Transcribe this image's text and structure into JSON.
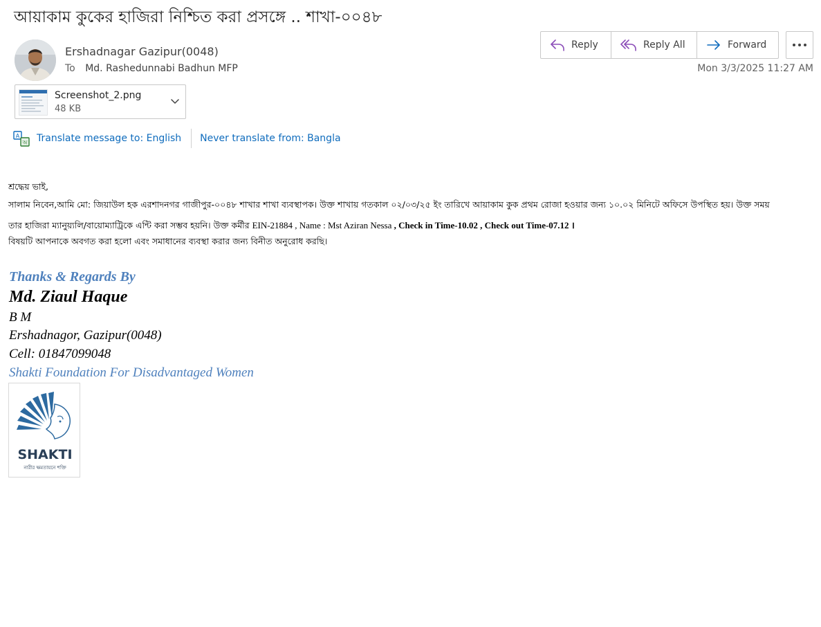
{
  "email": {
    "subject": "আয়াকাম কুকের হাজিরা নিশ্চিত করা প্রসঙ্গে .. শাখা-০০৪৮",
    "sender": "Ershadnagar Gazipur(0048)",
    "to_label": "To",
    "recipient": "Md. Rashedunnabi Badhun MFP",
    "date": "Mon 3/3/2025 11:27 AM"
  },
  "actions": {
    "reply": "Reply",
    "reply_all": "Reply All",
    "forward": "Forward",
    "more_icon": "more-horizontal-icon"
  },
  "attachment": {
    "name": "Screenshot_2.png",
    "size": "48 KB"
  },
  "translate": {
    "to_english": "Translate message to: English",
    "never_translate": "Never translate from: Bangla"
  },
  "body": {
    "greeting": "শ্রদ্ধেয় ভাই,",
    "line1": "সালাম নিবেন,আমি মো: জিয়াউল হক এরশাদনগর গাজীপুর-০০৪৮ শাখার শাখা ব্যবস্থাপক। উক্ত শাখায় গতকাল ০২/০৩/২৫ ইং তারিখে আয়াকাম কুক প্রথম রোজা হওয়ার জন্য ১০.০২ মিনিটে অফিসে উপস্থিত হয়। উক্ত সময়",
    "line2_a": "তার হাজিরা ম্যানুয়্যলি/বায়োম্যাট্রিকে এন্টি করা সম্ভব হয়নি। উক্ত কর্মীর ",
    "line2_b": "EIN-21884 ,  Name : Mst Aziran Nessa   ",
    "line2_c": ", Check in Time-10.02   , Check out Time-07.12",
    "line2_d": " ।",
    "line3": "বিষয়টি আপনাকে অবগত করা হলো এবং সমাধানের ব্যবস্থা করার জন্য বিনীত অনুরোধ করছি।"
  },
  "signature": {
    "thanks": "Thanks & Regards By",
    "name": "Md. Ziaul Haque",
    "role": "B M",
    "branch": "Ershadnagor, Gazipur(0048)",
    "cell": "Cell: 01847099048",
    "org": "Shakti Foundation For Disadvantaged Women"
  },
  "logo": {
    "word": "SHAKTI",
    "tagline": "নারীর ক্ষমতায়নে শক্তি"
  },
  "colors": {
    "link": "#0f6cbd",
    "signature_blue": "#4f81bd",
    "logo_navy": "#2a3f57",
    "reply_icon": "#8b4db8",
    "forward_icon": "#0f6cbd"
  }
}
